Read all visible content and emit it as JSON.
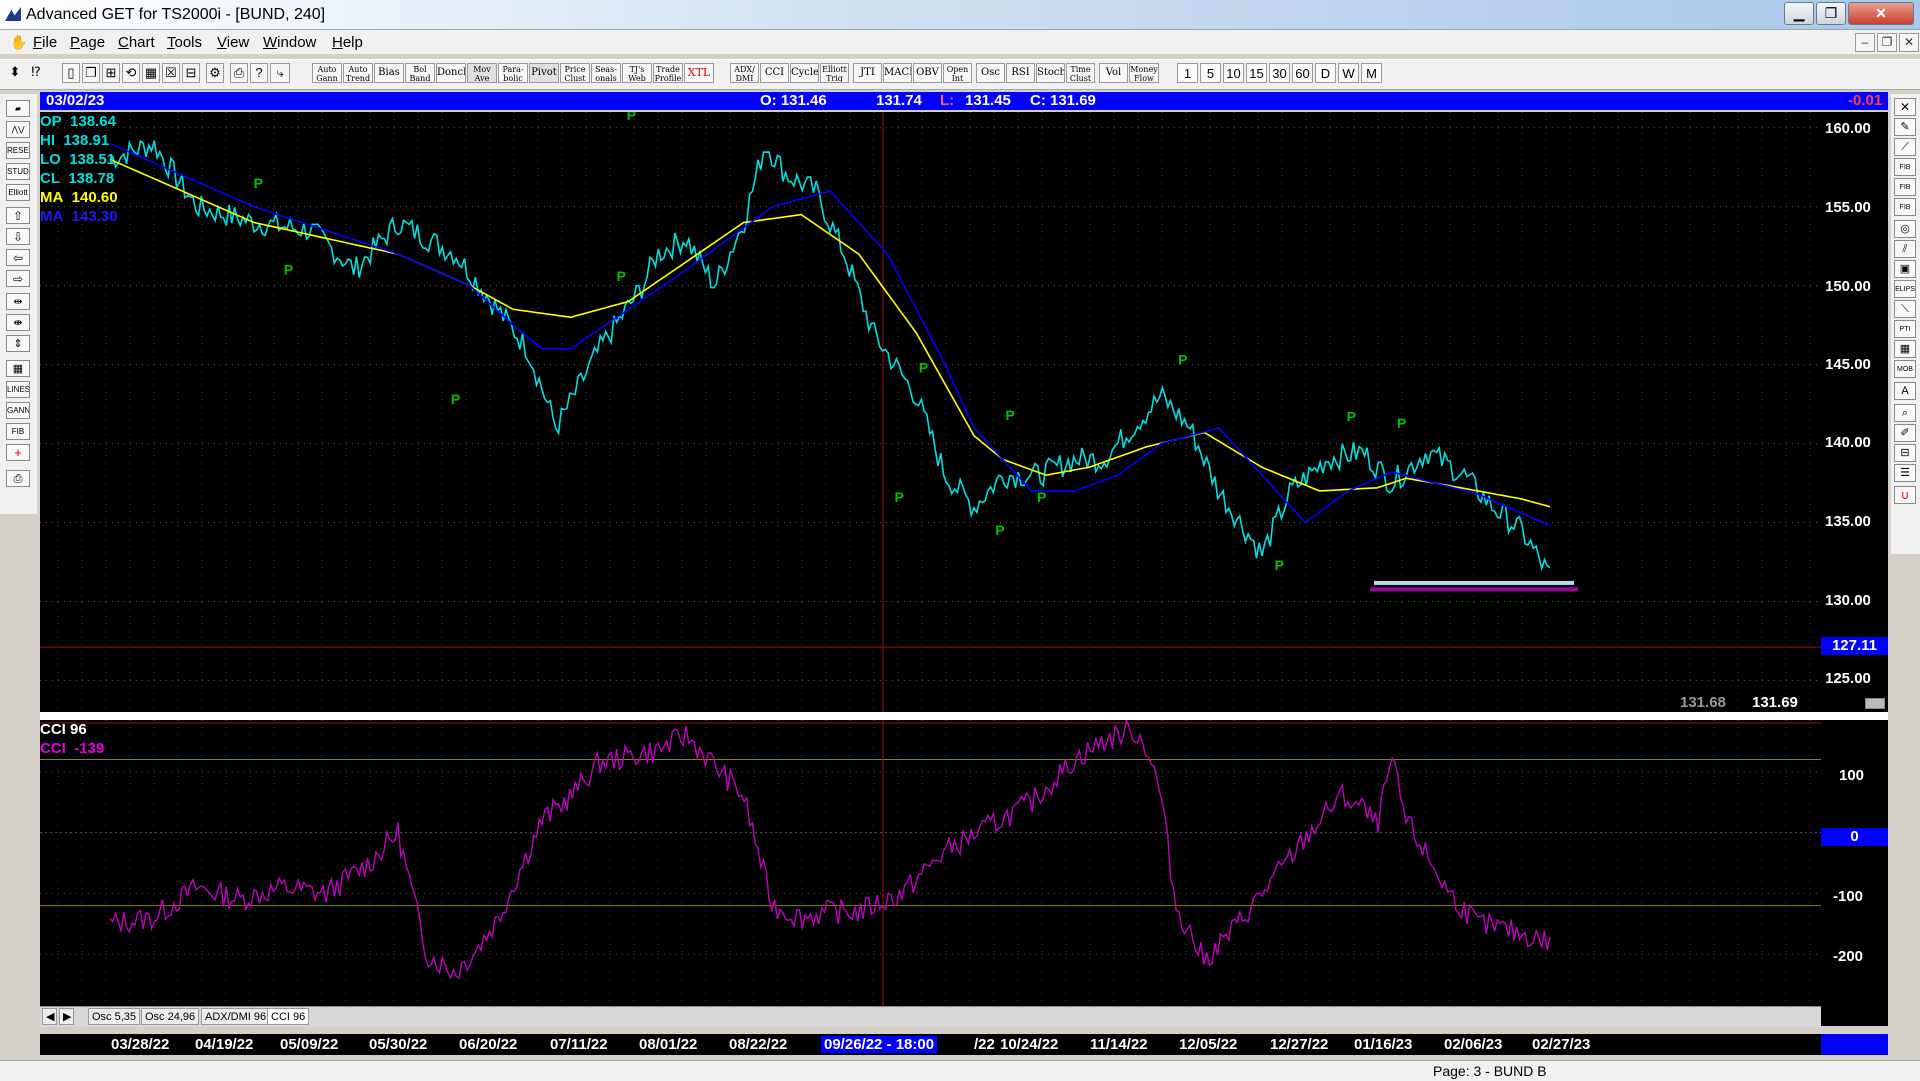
{
  "window": {
    "title": "Advanced GET for TS2000i - [BUND, 240]",
    "min": "▁",
    "max": "❐",
    "close": "✕"
  },
  "menu": [
    {
      "key": "F",
      "rest": "ile"
    },
    {
      "key": "P",
      "rest": "age"
    },
    {
      "key": "C",
      "rest": "hart"
    },
    {
      "key": "T",
      "rest": "ools"
    },
    {
      "key": "V",
      "rest": "iew"
    },
    {
      "key": "W",
      "rest": "indow"
    },
    {
      "key": "H",
      "rest": "elp"
    }
  ],
  "mdi": {
    "min": "‒",
    "restore": "❐",
    "close": "✕"
  },
  "toolbar": {
    "studies": [
      {
        "l1": "Auto",
        "l2": "Gann"
      },
      {
        "l1": "Auto",
        "l2": "Trend"
      },
      {
        "l1": "Bias",
        "l2": ""
      },
      {
        "l1": "Bol",
        "l2": "Band"
      },
      {
        "l1": "Donch",
        "l2": ""
      },
      {
        "l1": "Mov",
        "l2": "Ave"
      },
      {
        "l1": "Para-",
        "l2": "bolic"
      },
      {
        "l1": "Pivot",
        "l2": ""
      },
      {
        "l1": "Price",
        "l2": "Clust"
      },
      {
        "l1": "Seas-",
        "l2": "onals"
      },
      {
        "l1": "TJ's",
        "l2": "Web"
      },
      {
        "l1": "Trade",
        "l2": "Profile"
      }
    ],
    "xtl": "XTL",
    "osc": [
      {
        "l1": "ADX/",
        "l2": "DMI"
      },
      {
        "l1": "CCI",
        "l2": ""
      },
      {
        "l1": "Cycles",
        "l2": ""
      },
      {
        "l1": "Elliott",
        "l2": "Trig"
      },
      {
        "l1": "JTI",
        "l2": ""
      },
      {
        "l1": "MACD",
        "l2": ""
      },
      {
        "l1": "OBV",
        "l2": ""
      },
      {
        "l1": "Open",
        "l2": "Int"
      },
      {
        "l1": "Osc",
        "l2": ""
      },
      {
        "l1": "RSI",
        "l2": ""
      },
      {
        "l1": "Stoch",
        "l2": ""
      },
      {
        "l1": "Time",
        "l2": "Clust"
      },
      {
        "l1": "Vol",
        "l2": ""
      },
      {
        "l1": "Money",
        "l2": "Flow"
      }
    ],
    "periods": [
      "1",
      "5",
      "10",
      "15",
      "30",
      "60",
      "D",
      "W",
      "M"
    ]
  },
  "info": {
    "date": "03/02/23",
    "open": "O: 131.46",
    "high": "131.74",
    "low_label": "L:",
    "low": "131.45",
    "close": "C: 131.69",
    "change": "-0.01"
  },
  "legend": [
    {
      "label": "OP",
      "value": "138.64"
    },
    {
      "label": "HI",
      "value": "138.91"
    },
    {
      "label": "LO",
      "value": "138.51"
    },
    {
      "label": "CL",
      "value": "138.78"
    },
    {
      "label": "MA",
      "value": "140.60"
    },
    {
      "label": "MA",
      "value": "143.30"
    }
  ],
  "price_axis": [
    "160.00",
    "155.00",
    "150.00",
    "145.00",
    "140.00",
    "135.00",
    "130.00",
    "125.00"
  ],
  "price_marker": "127.11",
  "last_values": [
    "131.68",
    "131.69"
  ],
  "osc_legend": {
    "name": "CCI 96",
    "value_label": "CCI",
    "value": "-139"
  },
  "osc_axis": [
    "100",
    "0",
    "-100",
    "-200"
  ],
  "osc_zero_marker": "0",
  "pivot_label": "P",
  "tabs": [
    "Osc 5,35",
    "Osc 24,96",
    "ADX/DMI 96",
    "CCI 96"
  ],
  "dates": [
    "03/28/22",
    "04/19/22",
    "05/09/22",
    "05/30/22",
    "06/20/22",
    "07/11/22",
    "08/01/22",
    "08/22/22",
    "09/26/22 - 18:00",
    "/22",
    "10/24/22",
    "11/14/22",
    "12/05/22",
    "12/27/22",
    "01/16/23",
    "02/06/23",
    "02/27/23"
  ],
  "status": "Page: 3 - BUND B",
  "colors": {
    "price": "#00e0e0",
    "ma_fast": "#ffff00",
    "ma_slow": "#0000ff",
    "cci": "#c000c0",
    "pivot": "#00c000",
    "info_bar": "#0000ff"
  },
  "chart_data": [
    {
      "type": "line",
      "series": [
        {
          "name": "CL",
          "x": [
            0,
            0.03,
            0.06,
            0.1,
            0.14,
            0.17,
            0.2,
            0.24,
            0.265,
            0.29,
            0.31,
            0.34,
            0.37,
            0.38,
            0.4,
            0.42,
            0.44,
            0.455,
            0.47,
            0.49,
            0.51,
            0.53,
            0.56,
            0.58,
            0.6,
            0.62,
            0.645,
            0.67,
            0.69,
            0.71,
            0.73,
            0.75,
            0.77,
            0.8,
            0.82,
            0.845,
            0.87,
            0.89,
            0.915,
            0.94,
            0.96,
            0.98,
            1.0
          ],
          "y": [
            158,
            159,
            155,
            154,
            153.5,
            151,
            154,
            152,
            149,
            146,
            141,
            146,
            150,
            152,
            153,
            150,
            154,
            159,
            157,
            156,
            152,
            147,
            143,
            138,
            136,
            138,
            138,
            139,
            139,
            141,
            143,
            141,
            137,
            133,
            137,
            139,
            139.5,
            137.5,
            139.5,
            138,
            136,
            134.5,
            131.6
          ]
        },
        {
          "name": "MA",
          "x": [
            0,
            0.05,
            0.1,
            0.15,
            0.2,
            0.25,
            0.28,
            0.32,
            0.36,
            0.4,
            0.44,
            0.48,
            0.52,
            0.56,
            0.6,
            0.62,
            0.65,
            0.68,
            0.72,
            0.76,
            0.8,
            0.84,
            0.88,
            0.9,
            0.92,
            0.95,
            0.98,
            1.0
          ],
          "y": [
            158,
            156,
            154,
            153,
            152,
            150,
            148.5,
            148,
            149,
            151.5,
            154,
            154.5,
            152,
            147,
            140.5,
            139,
            138,
            138.5,
            139.8,
            140.7,
            138.5,
            137,
            137.2,
            137.8,
            137.5,
            137,
            136.5,
            136
          ]
        },
        {
          "name": "MA",
          "x": [
            0,
            0.05,
            0.1,
            0.15,
            0.2,
            0.25,
            0.28,
            0.3,
            0.32,
            0.36,
            0.4,
            0.43,
            0.46,
            0.5,
            0.54,
            0.58,
            0.6,
            0.64,
            0.67,
            0.7,
            0.73,
            0.77,
            0.8,
            0.83,
            0.86,
            0.89,
            0.92,
            0.95,
            1.0
          ],
          "y": [
            159,
            157,
            155,
            153.5,
            152,
            150,
            147.5,
            146,
            146,
            148.5,
            151,
            153,
            155,
            156,
            152,
            145,
            141,
            137,
            137,
            138,
            140,
            141,
            138,
            135,
            137,
            138.2,
            137.5,
            136.8,
            134.8
          ]
        }
      ],
      "ylim": [
        123,
        161
      ]
    },
    {
      "type": "line",
      "series": [
        {
          "name": "CCI",
          "x": [
            0,
            0.03,
            0.06,
            0.09,
            0.12,
            0.15,
            0.18,
            0.2,
            0.22,
            0.24,
            0.255,
            0.27,
            0.285,
            0.3,
            0.32,
            0.34,
            0.36,
            0.38,
            0.4,
            0.42,
            0.44,
            0.46,
            0.48,
            0.5,
            0.52,
            0.55,
            0.58,
            0.61,
            0.64,
            0.67,
            0.69,
            0.71,
            0.72,
            0.73,
            0.74,
            0.76,
            0.78,
            0.8,
            0.82,
            0.84,
            0.855,
            0.87,
            0.88,
            0.89,
            0.9,
            0.91,
            0.93,
            0.95,
            0.97,
            1.0
          ],
          "y": [
            -150,
            -140,
            -90,
            -110,
            -90,
            -100,
            -50,
            0,
            -200,
            -230,
            -190,
            -140,
            -60,
            20,
            60,
            115,
            125,
            135,
            160,
            110,
            60,
            -120,
            -140,
            -130,
            -130,
            -100,
            -30,
            10,
            50,
            120,
            150,
            170,
            140,
            60,
            -120,
            -210,
            -160,
            -100,
            -40,
            20,
            60,
            40,
            10,
            120,
            20,
            -20,
            -100,
            -150,
            -160,
            -180
          ]
        }
      ],
      "ylim": [
        -285,
        185
      ]
    }
  ]
}
